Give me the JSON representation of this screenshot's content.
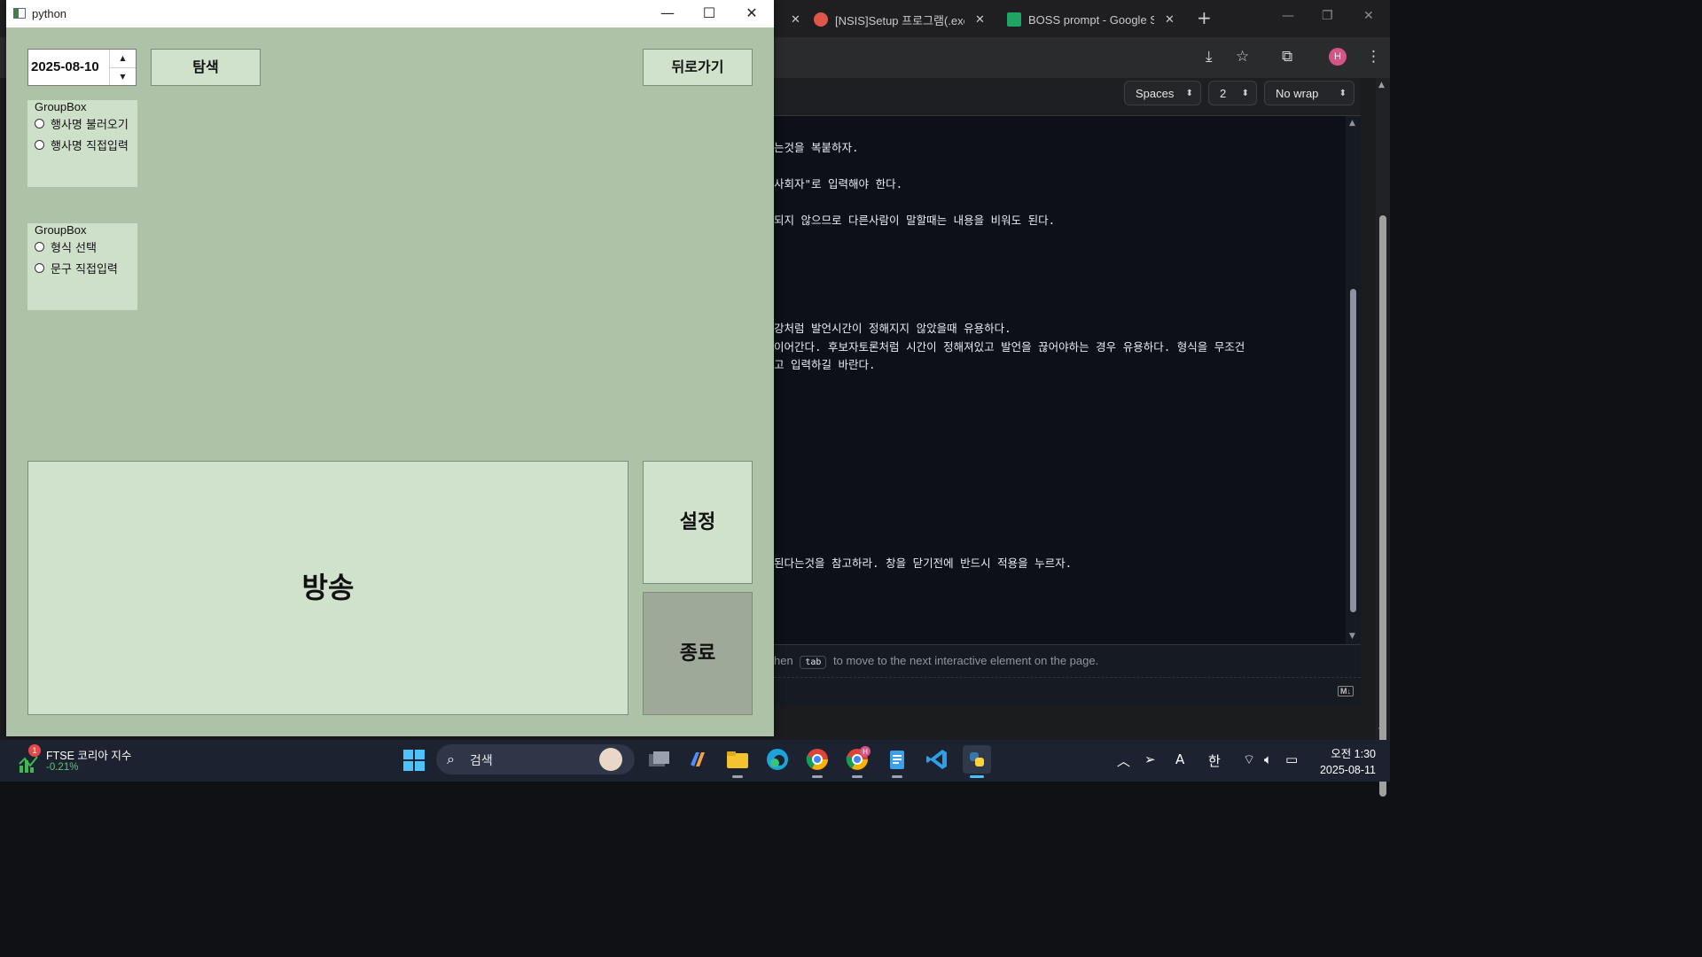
{
  "browser": {
    "tabs": [
      {
        "title": "[NSIS]Setup 프로그램(.exe",
        "favicon_color": "#e0564b"
      },
      {
        "title": "BOSS prompt - Google Sh",
        "favicon_color": "#1fa463"
      }
    ],
    "avatar_letter": "H",
    "editor": {
      "indent_mode": "Spaces",
      "indent_size": "2",
      "wrap_mode": "No wrap",
      "lines": [
        "는것을 복붙하자.",
        "사회자\"로 입력해야 한다.",
        "되지 않으므로 다른사람이 말할때는 내용을 비워도 된다.",
        "강처럼 발언시간이 정해지지 않았을때 유용하다.",
        "이어간다. 후보자토론처럼 시간이 정해져있고 발언을 끊어야하는 경우 유용하다. 형식을 무조건",
        "고 입력하길 바란다.",
        "된다는것을 참고하라. 창을 닫기전에 반드시 적용을 누르자."
      ],
      "hint_prefix": "hen",
      "hint_key": "tab",
      "hint_suffix": "to move to the next interactive element on the page.",
      "md_label": "M↓"
    }
  },
  "pywin": {
    "title": "python",
    "date_value": "2025-08-10",
    "search_label": "탐색",
    "back_label": "뒤로가기",
    "group1": {
      "title": "GroupBox",
      "options": [
        "행사명 불러오기",
        "행사명 직접입력"
      ]
    },
    "group2": {
      "title": "GroupBox",
      "options": [
        "형식 선택",
        "문구 직접입력"
      ]
    },
    "broadcast_label": "방송",
    "settings_label": "설정",
    "exit_label": "종료",
    "colors": {
      "background": "#adc2a7",
      "button": "#d0e2cb",
      "exit_button": "#9ea99a"
    }
  },
  "taskbar": {
    "widget": {
      "badge": "1",
      "title": "FTSE 코리아 지수",
      "change": "-0.21%"
    },
    "search_placeholder": "검색",
    "chrome_badge": "H",
    "tray_lang_a": "A",
    "tray_lang_ko": "한",
    "time": "오전 1:30",
    "date": "2025-08-11"
  }
}
